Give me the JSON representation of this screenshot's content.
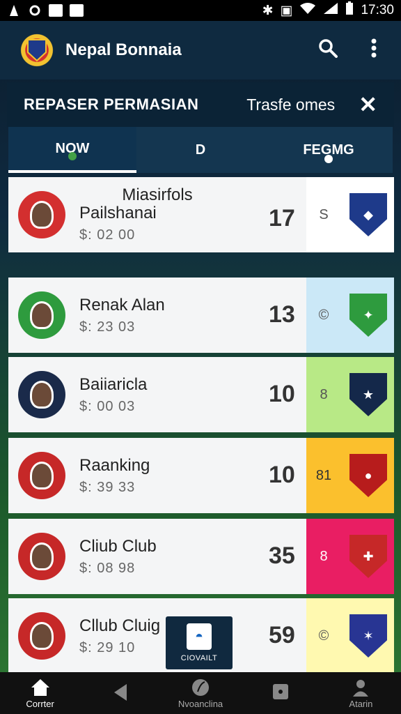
{
  "status_bar": {
    "time": "17:30"
  },
  "header": {
    "title": "Nepal Bonnaia"
  },
  "sub_header": {
    "left": "REPASER PERMASIAN",
    "right": "Trasfe omes"
  },
  "tabs": [
    {
      "label": "NOW"
    },
    {
      "label": "D"
    },
    {
      "label": "FEGMG"
    }
  ],
  "list": {
    "title": "Miasirfols",
    "rows": [
      {
        "name": "Pailshanai",
        "price": "$: 02  00",
        "score": "17",
        "side_glyph": "S",
        "side_color": "#ffffff",
        "crest_color": "#1e3a8a",
        "avatar_color": "#d32f2f"
      },
      {
        "name": "Renak Alan",
        "price": "$: 23  03",
        "score": "13",
        "side_glyph": "©",
        "side_color": "#cbe8f7",
        "crest_color": "#2e9b3e",
        "avatar_color": "#2e9b3e"
      },
      {
        "name": "Baiiaricla",
        "price": "$: 00  03",
        "score": "10",
        "side_glyph": "8",
        "side_color": "#b8e986",
        "crest_color": "#14284a",
        "avatar_color": "#1a2a4a"
      },
      {
        "name": "Raanking",
        "price": "$: 39  33",
        "score": "10",
        "side_glyph": "81",
        "side_color": "#fbc02d",
        "crest_color": "#b71c1c",
        "avatar_color": "#c62828"
      },
      {
        "name": "Cliub Club",
        "price": "$: 08  98",
        "score": "35",
        "side_glyph": "8",
        "side_color": "#e91e63",
        "crest_color": "#c62828",
        "avatar_color": "#c62828"
      },
      {
        "name": "Cllub Cluig",
        "price": "$: 29  10",
        "score": "59",
        "side_glyph": "©",
        "side_color": "#fff9b0",
        "crest_color": "#283593",
        "avatar_color": "#c62828"
      }
    ]
  },
  "floating_card": {
    "label": "CIOVAILT"
  },
  "bottom_nav": [
    {
      "label": "Corrter",
      "icon": "home-icon"
    },
    {
      "label": "",
      "icon": "back-icon"
    },
    {
      "label": "Nvoanclina",
      "icon": "ball-icon"
    },
    {
      "label": "",
      "icon": "square-icon"
    },
    {
      "label": "Atarin",
      "icon": "user-icon"
    }
  ],
  "colors": {
    "header_bg": "#0f2a40",
    "accent": "#ffffff"
  }
}
